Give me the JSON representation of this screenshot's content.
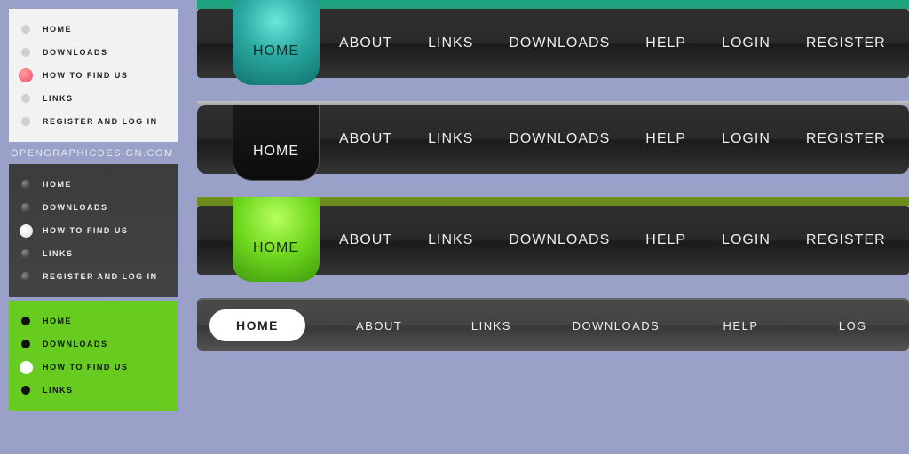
{
  "credit": "OPENGRAPHICDESIGN.COM",
  "sidemenu": {
    "items": [
      {
        "label": "HOME"
      },
      {
        "label": "DOWNLOADS"
      },
      {
        "label": "HOW TO FIND US"
      },
      {
        "label": "LINKS"
      },
      {
        "label": "REGISTER AND LOG IN"
      }
    ],
    "green_items": [
      {
        "label": "HOME"
      },
      {
        "label": "DOWNLOADS"
      },
      {
        "label": "HOW TO FIND US"
      },
      {
        "label": "LINKS"
      }
    ]
  },
  "hmenu": {
    "active": "HOME",
    "items": [
      {
        "label": "ABOUT"
      },
      {
        "label": "LINKS"
      },
      {
        "label": "DOWNLOADS"
      },
      {
        "label": "HELP"
      },
      {
        "label": "LOGIN"
      },
      {
        "label": "REGISTER"
      }
    ]
  },
  "pillmenu": {
    "active": "HOME",
    "items": [
      {
        "label": "ABOUT"
      },
      {
        "label": "LINKS"
      },
      {
        "label": "DOWNLOADS"
      },
      {
        "label": "HELP"
      },
      {
        "label": "LOG"
      }
    ]
  }
}
